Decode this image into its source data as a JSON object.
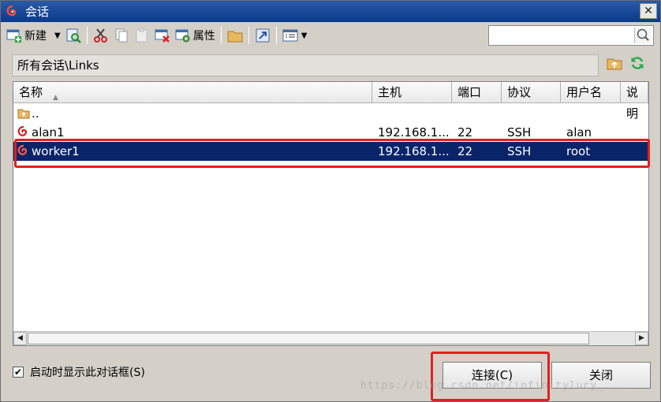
{
  "window": {
    "title": "会话",
    "close_glyph": "✕"
  },
  "toolbar": {
    "new_label": "新建",
    "properties_label": "属性",
    "search_placeholder": ""
  },
  "path": {
    "text": "所有会话\\Links"
  },
  "table": {
    "columns": [
      "名称",
      "主机",
      "端口",
      "协议",
      "用户名",
      "说明"
    ],
    "rows": [
      {
        "name": "..",
        "host": "",
        "port": "",
        "protocol": "",
        "user": "",
        "icon": "folder-up-icon",
        "selected": false
      },
      {
        "name": "alan1",
        "host": "192.168.1...",
        "port": "22",
        "protocol": "SSH",
        "user": "alan",
        "icon": "session-icon",
        "selected": false
      },
      {
        "name": "worker1",
        "host": "192.168.1...",
        "port": "22",
        "protocol": "SSH",
        "user": "root",
        "icon": "session-icon",
        "selected": true
      }
    ]
  },
  "footer": {
    "checkbox_label": "启动时显示此对话框(S)",
    "checkbox_checked": true,
    "connect_label": "连接(C)",
    "close_label": "关闭",
    "watermark": "https://blog.csdn.net/infinitylucy_..."
  },
  "colors": {
    "title_bar": "#0a3a8a",
    "selection": "#0a246a",
    "highlight_box": "#e02020",
    "app_red": "#d42020"
  }
}
